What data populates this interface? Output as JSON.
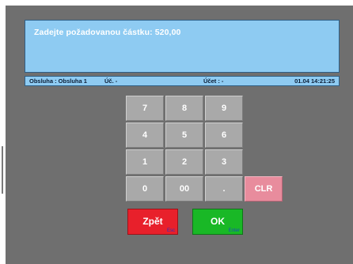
{
  "display": {
    "prompt": "Zadejte požadovanou částku: 520,00"
  },
  "status": {
    "operator": "Obsluha : Obsluha 1",
    "uc": "Úč. -",
    "ucet": "Účet : -",
    "datetime": "01.04 14:21:25"
  },
  "keypad": {
    "k7": "7",
    "k8": "8",
    "k9": "9",
    "k4": "4",
    "k5": "5",
    "k6": "6",
    "k1": "1",
    "k2": "2",
    "k3": "3",
    "k0": "0",
    "k00": "00",
    "kdot": ".",
    "clr": "CLR"
  },
  "actions": {
    "back_label": "Zpět",
    "back_hint": "Esc",
    "ok_label": "OK",
    "ok_hint": "Enter"
  },
  "colors": {
    "background": "#6f6f6f",
    "display": "#8ecbf2",
    "key": "#a9a9a9",
    "clr": "#e88c9d",
    "back": "#e8202b",
    "ok": "#19b826"
  }
}
